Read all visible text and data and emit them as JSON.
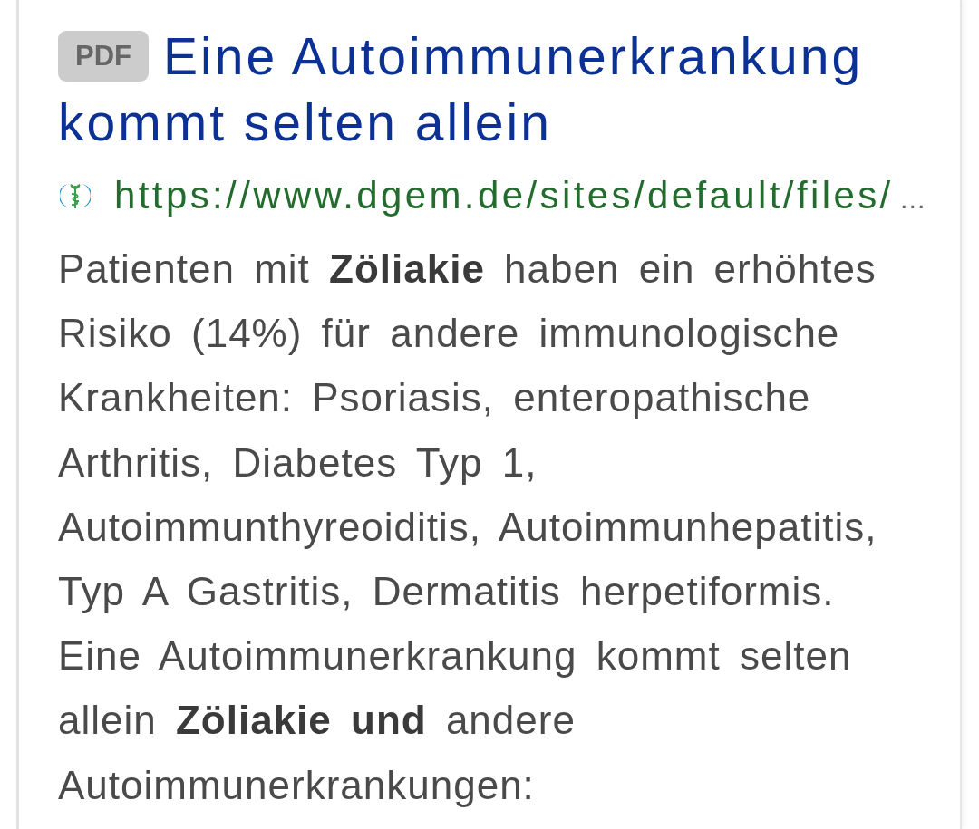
{
  "result": {
    "badge": "PDF",
    "title": "Eine Autoimmunerkrankung kommt selten allein",
    "url": "https://www.dgem.de/sites/default/files/",
    "url_ellipsis": "…",
    "snippet": "Patienten mit **Zöliakie** haben ein erhöhtes Risiko (14%) für andere immunologische Krankheiten: Psoriasis, enteropathische Arthritis, Diabetes Typ 1, Autoimmunthyreoiditis, Autoimmunhepatitis, Typ A Gastritis, Dermatitis herpetiformis. Eine Autoimmunerkrankung kommt selten allein **Zöliakie und** andere Autoimmunerkrankungen:"
  }
}
